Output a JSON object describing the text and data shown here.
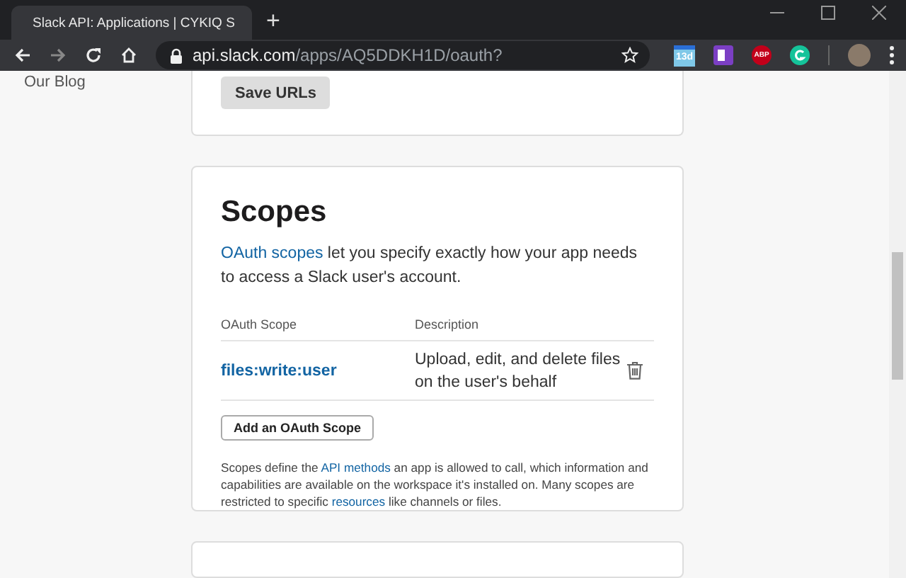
{
  "browser": {
    "tab_title": "Slack API: Applications | CYKIQ S",
    "new_tab": "+",
    "url_host": "api.slack.com",
    "url_path": "/apps/AQ5DDKH1D/oauth?",
    "extensions": [
      {
        "kind": "calendar",
        "label": "13d"
      },
      {
        "kind": "note"
      },
      {
        "kind": "adblock",
        "label": "ABP"
      },
      {
        "kind": "grammar"
      }
    ]
  },
  "sidebar": {
    "items": [
      "Our Blog"
    ]
  },
  "redirect_card": {
    "save_button": "Save URLs"
  },
  "scopes_card": {
    "title": "Scopes",
    "intro": [
      {
        "text": "OAuth scopes",
        "link": true
      },
      {
        "text": " let you specify exactly how your app needs to access a Slack user's account.",
        "link": false
      }
    ],
    "columns": [
      "OAuth Scope",
      "Description"
    ],
    "rows": [
      {
        "scope": "files:write:user",
        "description": "Upload, edit, and delete files on the user's behalf"
      }
    ],
    "add_button": "Add an OAuth Scope",
    "note": [
      {
        "text": "Scopes define the ",
        "link": false
      },
      {
        "text": "API methods",
        "link": true
      },
      {
        "text": " an app is allowed to call, which information and capabilities are available on the workspace it's installed on. Many scopes are restricted to specific ",
        "link": false
      },
      {
        "text": "resources",
        "link": true
      },
      {
        "text": " like channels or files.",
        "link": false
      }
    ]
  }
}
